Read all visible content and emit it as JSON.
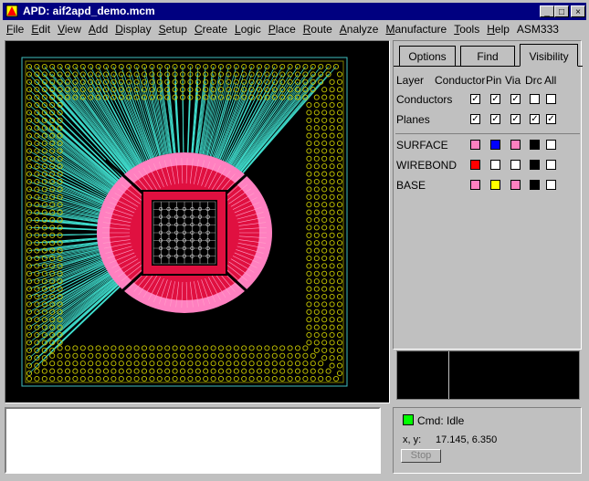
{
  "window": {
    "title": "APD:  aif2apd_demo.mcm"
  },
  "titlebar_buttons": {
    "minimize": "_",
    "maximize": "□",
    "close": "×"
  },
  "menus": [
    {
      "pre": "",
      "u": "F",
      "post": "ile"
    },
    {
      "pre": "",
      "u": "E",
      "post": "dit"
    },
    {
      "pre": "",
      "u": "V",
      "post": "iew"
    },
    {
      "pre": "",
      "u": "A",
      "post": "dd"
    },
    {
      "pre": "",
      "u": "D",
      "post": "isplay"
    },
    {
      "pre": "",
      "u": "S",
      "post": "etup"
    },
    {
      "pre": "",
      "u": "C",
      "post": "reate"
    },
    {
      "pre": "",
      "u": "L",
      "post": "ogic"
    },
    {
      "pre": "",
      "u": "P",
      "post": "lace"
    },
    {
      "pre": "",
      "u": "R",
      "post": "oute"
    },
    {
      "pre": "",
      "u": "A",
      "post": "nalyze"
    },
    {
      "pre": "",
      "u": "M",
      "post": "anufacture"
    },
    {
      "pre": "",
      "u": "T",
      "post": "ools"
    },
    {
      "pre": "",
      "u": "H",
      "post": "elp"
    },
    {
      "pre": "",
      "u": "",
      "post": "ASM333"
    }
  ],
  "panel": {
    "tabs": [
      "Options",
      "Find",
      "Visibility"
    ],
    "active_tab": "Visibility",
    "headers": {
      "layer": "Layer",
      "conductor": "Conductor",
      "pin": "Pin",
      "via": "Via",
      "drc": "Drc",
      "all": "All"
    },
    "global_rows": [
      {
        "label": "Conductors",
        "checks": [
          true,
          true,
          true,
          false,
          false
        ]
      },
      {
        "label": "Planes",
        "checks": [
          true,
          true,
          true,
          true,
          true
        ]
      }
    ],
    "layers": [
      {
        "label": "SURFACE",
        "colors": [
          "#ff80c0",
          "#0000ff",
          "#ff80c0",
          "#000000"
        ],
        "all": false
      },
      {
        "label": "WIREBOND",
        "colors": [
          "#ff0000",
          "#ffffff",
          "#ffffff",
          "#000000"
        ],
        "all": false
      },
      {
        "label": "BASE",
        "colors": [
          "#ff80c0",
          "#ffff00",
          "#ff80c0",
          "#000000"
        ],
        "all": false
      }
    ]
  },
  "status": {
    "cmd_label": "Cmd:",
    "cmd_value": "Idle",
    "xy_label": "x, y:",
    "xy_value": "17.145, 6.350",
    "stop_label": "Stop",
    "led_color": "#00ff00"
  },
  "colors": {
    "canvas_bg": "#000000",
    "pad_ring": "#c8c800",
    "bond_wire": "#40e0d0",
    "die_outer": "#ff80c0",
    "die_inner": "#e01040",
    "title_bar": "#000080"
  }
}
